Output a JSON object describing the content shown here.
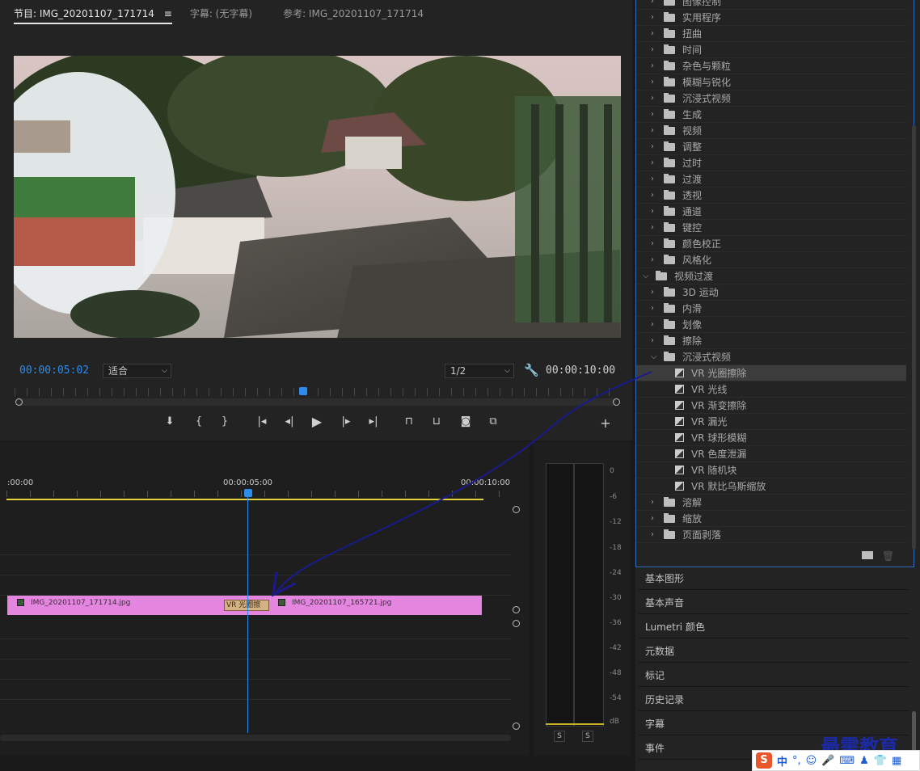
{
  "monitor": {
    "tabs": [
      {
        "label": "节目: IMG_20201107_171714",
        "menu": "≡"
      },
      {
        "label": "字幕: (无字幕)"
      },
      {
        "label": "参考: IMG_20201107_171714"
      }
    ],
    "timecode_current": "00:00:05:02",
    "zoom": "适合",
    "resolution": "1/2",
    "timecode_duration": "00:00:10:00",
    "playhead_fraction": 0.5,
    "controls": [
      "marker",
      "mark-in",
      "mark-out",
      "go-to-in",
      "step-back",
      "play",
      "step-forward",
      "go-to-out",
      "lift",
      "extract",
      "export-frame",
      "compare",
      "add"
    ]
  },
  "timeline": {
    "ruler": [
      ":00:00",
      "00:00:05:00",
      "00:00:10:00"
    ],
    "clips": [
      {
        "name": "IMG_20201107_171714.jpg",
        "color": "#e486e0"
      },
      {
        "name": "IMG_20201107_165721.jpg",
        "color": "#e486e0"
      }
    ],
    "transition": "VR 光圈擦",
    "work_area_color": "#e2d13a"
  },
  "meters": {
    "scale": [
      "0",
      "-6",
      "-12",
      "-18",
      "-24",
      "-30",
      "-36",
      "-42",
      "-48",
      "-54",
      "dB"
    ],
    "solo": [
      "S",
      "S"
    ]
  },
  "effects": {
    "items": [
      {
        "label": "图像控制",
        "type": "folder",
        "level": 1,
        "open": false
      },
      {
        "label": "实用程序",
        "type": "folder",
        "level": 1,
        "open": false
      },
      {
        "label": "扭曲",
        "type": "folder",
        "level": 1,
        "open": false
      },
      {
        "label": "时间",
        "type": "folder",
        "level": 1,
        "open": false
      },
      {
        "label": "杂色与颗粒",
        "type": "folder",
        "level": 1,
        "open": false
      },
      {
        "label": "模糊与锐化",
        "type": "folder",
        "level": 1,
        "open": false
      },
      {
        "label": "沉浸式视频",
        "type": "folder",
        "level": 1,
        "open": false
      },
      {
        "label": "生成",
        "type": "folder",
        "level": 1,
        "open": false
      },
      {
        "label": "视频",
        "type": "folder",
        "level": 1,
        "open": false
      },
      {
        "label": "调整",
        "type": "folder",
        "level": 1,
        "open": false
      },
      {
        "label": "过时",
        "type": "folder",
        "level": 1,
        "open": false
      },
      {
        "label": "过渡",
        "type": "folder",
        "level": 1,
        "open": false
      },
      {
        "label": "透视",
        "type": "folder",
        "level": 1,
        "open": false
      },
      {
        "label": "通道",
        "type": "folder",
        "level": 1,
        "open": false
      },
      {
        "label": "键控",
        "type": "folder",
        "level": 1,
        "open": false
      },
      {
        "label": "颜色校正",
        "type": "folder",
        "level": 1,
        "open": false
      },
      {
        "label": "风格化",
        "type": "folder",
        "level": 1,
        "open": false
      },
      {
        "label": "视频过渡",
        "type": "folder",
        "level": 0,
        "open": true
      },
      {
        "label": "3D 运动",
        "type": "folder",
        "level": 1,
        "open": false
      },
      {
        "label": "内滑",
        "type": "folder",
        "level": 1,
        "open": false
      },
      {
        "label": "划像",
        "type": "folder",
        "level": 1,
        "open": false
      },
      {
        "label": "擦除",
        "type": "folder",
        "level": 1,
        "open": false
      },
      {
        "label": "沉浸式视频",
        "type": "folder",
        "level": 1,
        "open": true
      },
      {
        "label": "VR 光圈擦除",
        "type": "effect",
        "level": 2,
        "selected": true
      },
      {
        "label": "VR 光线",
        "type": "effect",
        "level": 2
      },
      {
        "label": "VR 渐变擦除",
        "type": "effect",
        "level": 2
      },
      {
        "label": "VR 漏光",
        "type": "effect",
        "level": 2
      },
      {
        "label": "VR 球形模糊",
        "type": "effect",
        "level": 2
      },
      {
        "label": "VR 色度泄漏",
        "type": "effect",
        "level": 2
      },
      {
        "label": "VR 随机块",
        "type": "effect",
        "level": 2
      },
      {
        "label": "VR 默比乌斯缩放",
        "type": "effect",
        "level": 2
      },
      {
        "label": "溶解",
        "type": "folder",
        "level": 1,
        "open": false
      },
      {
        "label": "缩放",
        "type": "folder",
        "level": 1,
        "open": false
      },
      {
        "label": "页面剥落",
        "type": "folder",
        "level": 1,
        "open": false
      }
    ]
  },
  "panels": [
    "基本图形",
    "基本声音",
    "Lumetri 颜色",
    "元数据",
    "标记",
    "历史记录",
    "字幕",
    "事件"
  ],
  "watermark": "最需教育",
  "ime": {
    "logo": "S",
    "lang": "中",
    "punct": "°,"
  },
  "colors": {
    "accent": "#2d8ceb",
    "clip": "#e486e0",
    "arrow": "#1a1a8c"
  }
}
